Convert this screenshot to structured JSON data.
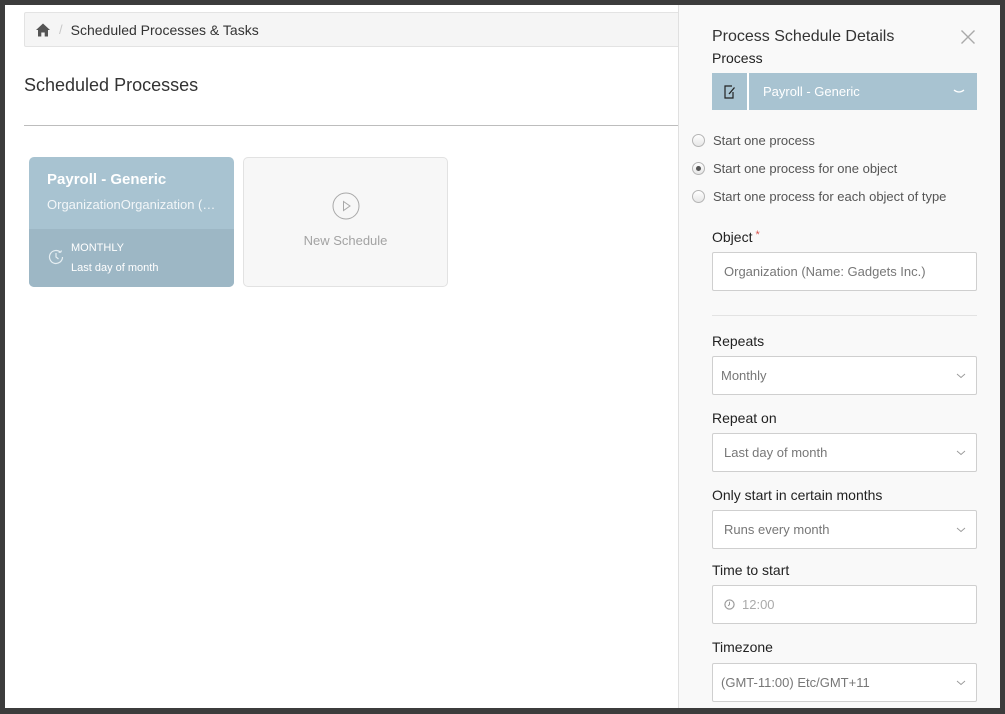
{
  "breadcrumb": {
    "home_icon": "home-icon",
    "separator": "/",
    "current": "Scheduled Processes & Tasks"
  },
  "page": {
    "title": "Scheduled Processes"
  },
  "cards": {
    "active": {
      "title": "Payroll - Generic",
      "subtitle": "OrganizationOrganization (N...",
      "frequency": "MONTHLY",
      "when": "Last day of month",
      "icon": "clock-icon"
    },
    "new": {
      "label": "New Schedule",
      "icon": "play-circle-icon"
    }
  },
  "panel": {
    "title": "Process Schedule Details",
    "close_icon": "close-icon",
    "process": {
      "label": "Process",
      "value": "Payroll - Generic",
      "icon": "edit-document-icon"
    },
    "start_options": [
      {
        "label": "Start one process",
        "checked": false
      },
      {
        "label": "Start one process for one object",
        "checked": true
      },
      {
        "label": "Start one process for each object of type",
        "checked": false
      }
    ],
    "object": {
      "label": "Object",
      "required_mark": "*",
      "value": "Organization (Name: Gadgets Inc.)"
    },
    "repeats": {
      "label": "Repeats",
      "value": "Monthly"
    },
    "repeat_on": {
      "label": "Repeat on",
      "value": "Last day of month"
    },
    "months": {
      "label": "Only start in certain months",
      "value": "Runs every month"
    },
    "time": {
      "label": "Time to start",
      "value": "12:00"
    },
    "timezone": {
      "label": "Timezone",
      "value": "(GMT-11:00) Etc/GMT+11"
    }
  },
  "colors": {
    "accent": "#a8c3d1",
    "accent_dark": "#9db7c5",
    "frame": "#3c3c3c",
    "required": "#d9534f"
  }
}
